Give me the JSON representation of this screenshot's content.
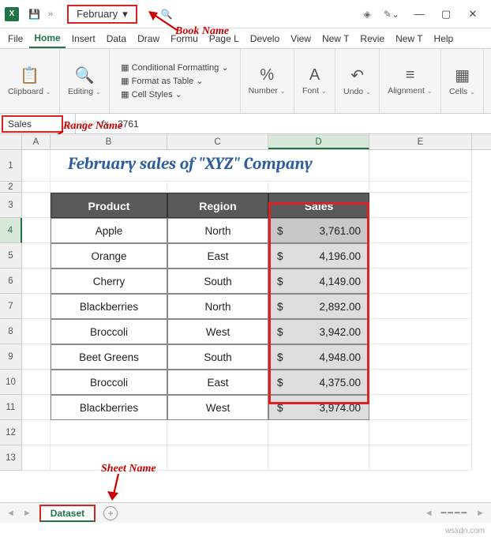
{
  "titlebar": {
    "app_letter": "X",
    "book_name": "February",
    "search_glyph": "🔍",
    "save_glyph": "💾",
    "overflow": "»"
  },
  "annotations": {
    "book_name": "Book Name",
    "range_name": "Range Name",
    "sheet_name": "Sheet Name"
  },
  "menu": {
    "file": "File",
    "home": "Home",
    "insert": "Insert",
    "data": "Data",
    "draw": "Draw",
    "formulas": "Formu",
    "pagelayout": "Page L",
    "developer": "Develo",
    "view": "View",
    "newtab1": "New T",
    "review": "Revie",
    "newtab2": "New T",
    "help": "Help"
  },
  "ribbon": {
    "clipboard": "Clipboard",
    "editing": "Editing",
    "cond_fmt": "Conditional Formatting",
    "fmt_table": "Format as Table",
    "cell_styles": "Cell Styles",
    "number": "Number",
    "font": "Font",
    "undo": "Undo",
    "alignment": "Alignment",
    "cells": "Cells"
  },
  "namebox": {
    "value": "Sales"
  },
  "formula": {
    "fx": "fx",
    "value": "3761"
  },
  "columns": {
    "A": "A",
    "B": "B",
    "C": "C",
    "D": "D",
    "E": "E"
  },
  "title_text": "February sales of \"XYZ\" Company",
  "headers": {
    "product": "Product",
    "region": "Region",
    "sales": "Sales"
  },
  "rows": [
    {
      "product": "Apple",
      "region": "North",
      "cur": "$",
      "sales": "3,761.00"
    },
    {
      "product": "Orange",
      "region": "East",
      "cur": "$",
      "sales": "4,196.00"
    },
    {
      "product": "Cherry",
      "region": "South",
      "cur": "$",
      "sales": "4,149.00"
    },
    {
      "product": "Blackberries",
      "region": "North",
      "cur": "$",
      "sales": "2,892.00"
    },
    {
      "product": "Broccoli",
      "region": "West",
      "cur": "$",
      "sales": "3,942.00"
    },
    {
      "product": "Beet Greens",
      "region": "South",
      "cur": "$",
      "sales": "4,948.00"
    },
    {
      "product": "Broccoli",
      "region": "East",
      "cur": "$",
      "sales": "4,375.00"
    },
    {
      "product": "Blackberries",
      "region": "West",
      "cur": "$",
      "sales": "3,974.00"
    }
  ],
  "sheet": {
    "name": "Dataset",
    "add": "+"
  },
  "status": {
    "watermark": "wsxdn.com"
  },
  "chart_data": {
    "type": "table",
    "title": "February sales of \"XYZ\" Company",
    "columns": [
      "Product",
      "Region",
      "Sales"
    ],
    "data": [
      [
        "Apple",
        "North",
        3761.0
      ],
      [
        "Orange",
        "East",
        4196.0
      ],
      [
        "Cherry",
        "South",
        4149.0
      ],
      [
        "Blackberries",
        "North",
        2892.0
      ],
      [
        "Broccoli",
        "West",
        3942.0
      ],
      [
        "Beet Greens",
        "South",
        4948.0
      ],
      [
        "Broccoli",
        "East",
        4375.0
      ],
      [
        "Blackberries",
        "West",
        3974.0
      ]
    ]
  }
}
